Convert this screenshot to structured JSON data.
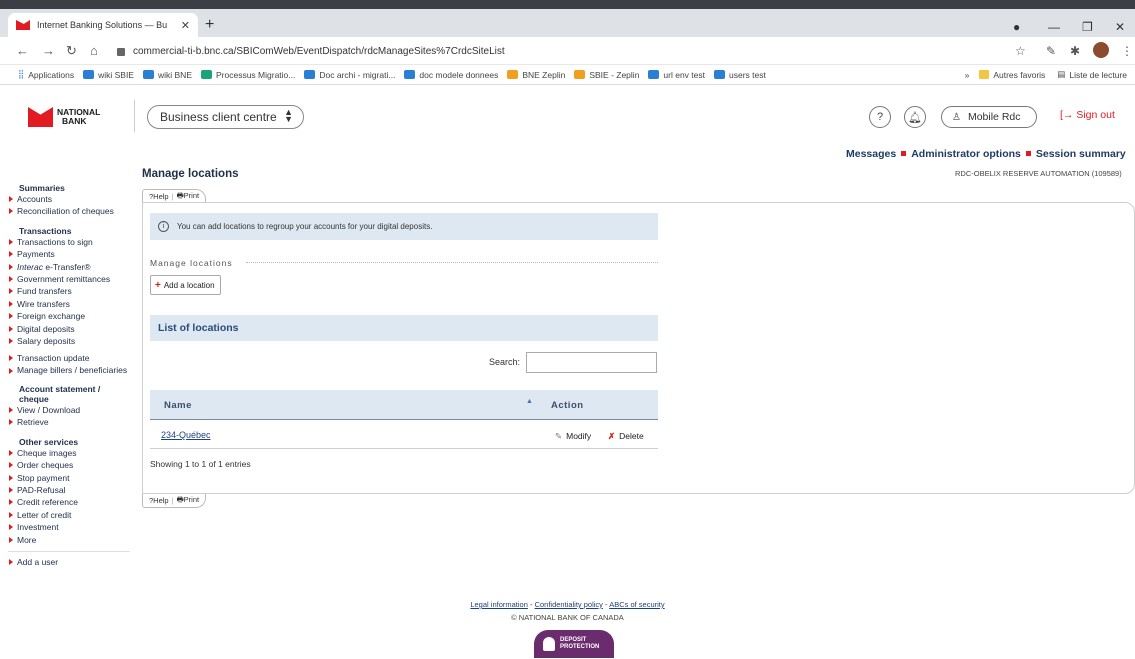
{
  "browser": {
    "tab_title": "Internet Banking Solutions — Bu",
    "url": "commercial-ti-b.bnc.ca/SBIComWeb/EventDispatch/rdcManageSites%7CrdcSiteList",
    "bookmarks": [
      {
        "label": "Applications",
        "color": "#f0a020"
      },
      {
        "label": "wiki SBIE",
        "color": "#2a7fd4"
      },
      {
        "label": "wiki BNE",
        "color": "#2a7fd4"
      },
      {
        "label": "Processus Migratio...",
        "color": "#1aa37a"
      },
      {
        "label": "Doc archi - migrati...",
        "color": "#2a7fd4"
      },
      {
        "label": "doc modele donnees",
        "color": "#2a7fd4"
      },
      {
        "label": "BNE Zeplin",
        "color": "#f0a020"
      },
      {
        "label": "SBIE - Zeplin",
        "color": "#f0a020"
      },
      {
        "label": "url env test",
        "color": "#2a7fd4"
      },
      {
        "label": "users test",
        "color": "#2a7fd4"
      }
    ],
    "other_bookmarks": "Autres favoris",
    "reading_list": "Liste de lecture",
    "more": "»"
  },
  "header": {
    "logo_line1": "NATIONAL",
    "logo_line2": "BANK",
    "client_centre": "Business client centre",
    "help_icon": "?",
    "mobile_rdc": "Mobile Rdc",
    "sign_out": "Sign out"
  },
  "top_links": {
    "messages": "Messages",
    "admin": "Administrator options",
    "session": "Session summary"
  },
  "company": "RDC-OBELIX RESERVE AUTOMATION (109589)",
  "sidebar": {
    "summaries_title": "Summaries",
    "summaries": [
      "Accounts",
      "Reconciliation of cheques"
    ],
    "transactions_title": "Transactions",
    "transactions": [
      "Transactions to sign",
      "Payments"
    ],
    "interac_italic": "Interac",
    "interac_rest": " e-Transfer®",
    "transactions2": [
      "Government remittances",
      "Fund transfers",
      "Wire transfers",
      "Foreign exchange",
      "Digital deposits",
      "Salary deposits"
    ],
    "transactions3": [
      "Transaction update",
      "Manage billers / beneficiaries"
    ],
    "statement_title": "Account statement / cheque",
    "statement": [
      "View / Download",
      "Retrieve"
    ],
    "other_title": "Other services",
    "other": [
      "Cheque images",
      "Order cheques",
      "Stop payment",
      "PAD-Refusal",
      "Credit reference",
      "Letter of credit",
      "Investment",
      "More"
    ],
    "add_user": "Add a user"
  },
  "main": {
    "title": "Manage locations",
    "help": "Help",
    "print": "Print",
    "info": "You can add locations to regroup your accounts for your digital deposits.",
    "section_label": "Manage locations",
    "add_location": "Add a location",
    "list_title": "List of locations",
    "search_label": "Search:",
    "search_value": "",
    "col_name": "Name",
    "col_action": "Action",
    "rows": [
      {
        "name": "234-Québec",
        "modify": "Modify",
        "delete": "Delete"
      }
    ],
    "showing": "Showing 1 to 1 of 1 entries"
  },
  "footer": {
    "legal": "Legal information",
    "confidentiality": "Confidentiality policy",
    "abcs": "ABCs of security",
    "copyright": "© NATIONAL BANK OF CANADA",
    "deposit_line1": "DEPOSIT",
    "deposit_line2": "PROTECTION"
  }
}
